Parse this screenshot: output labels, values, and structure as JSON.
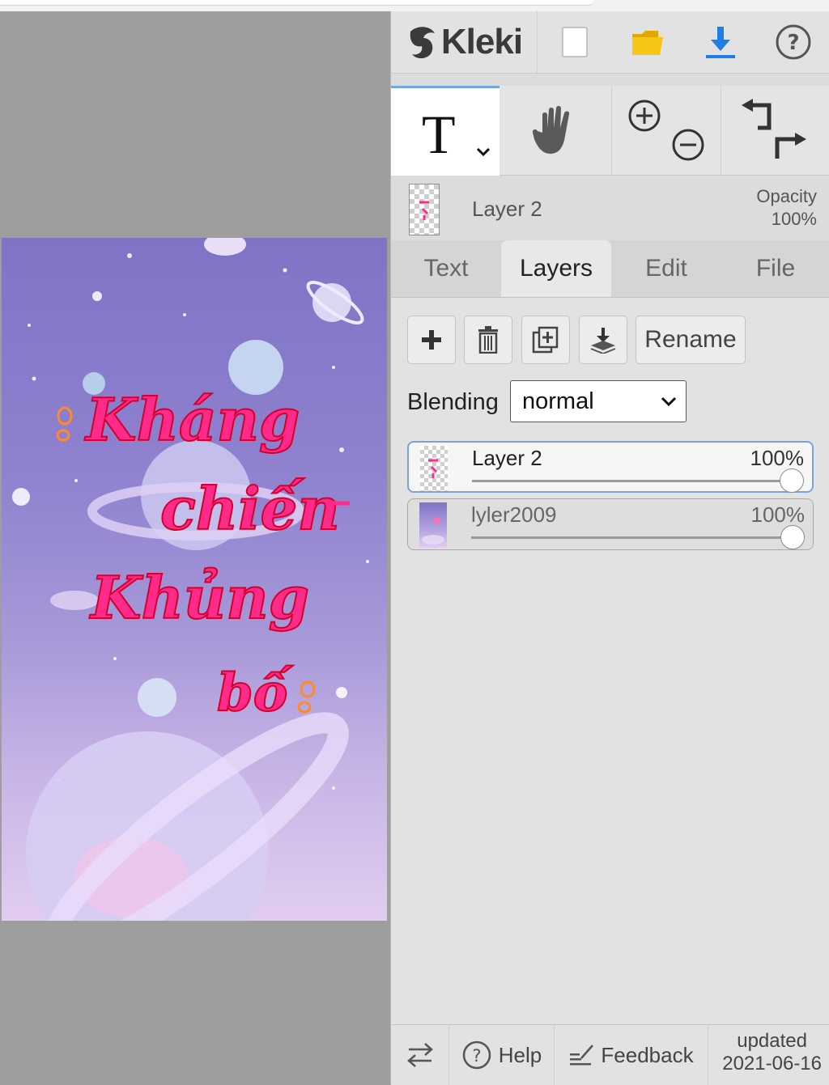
{
  "app": {
    "logo_text": "Kleki"
  },
  "toolbar": {
    "icons": [
      "new-image-icon",
      "open-folder-icon",
      "download-icon",
      "help-circle-icon"
    ]
  },
  "tools": {
    "active": "text-tool",
    "icons": [
      "text-tool-icon",
      "hand-tool-icon",
      "zoom-in-icon",
      "zoom-out-icon",
      "undo-icon",
      "redo-icon"
    ]
  },
  "current_layer": {
    "name": "Layer 2",
    "opacity_label": "Opacity",
    "opacity_value": "100%"
  },
  "tabs": [
    {
      "label": "Text"
    },
    {
      "label": "Layers"
    },
    {
      "label": "Edit"
    },
    {
      "label": "File"
    }
  ],
  "layers_panel": {
    "rename_label": "Rename",
    "blending_label": "Blending",
    "blending_value": "normal",
    "layers": [
      {
        "name": "Layer 2",
        "opacity": "100%",
        "opacity_fraction": 1.0,
        "selected": true
      },
      {
        "name": "lyler2009",
        "opacity": "100%",
        "opacity_fraction": 1.0,
        "selected": false
      }
    ]
  },
  "footer": {
    "help_label": "Help",
    "feedback_label": "Feedback",
    "updated_label": "updated",
    "updated_date": "2021-06-16"
  },
  "canvas": {
    "text_lines": [
      "Kháng",
      "chiến",
      "Khủng",
      "bố"
    ],
    "colors": {
      "text_fill": "#ff2b8a",
      "text_outline": "#d4002c",
      "accent": "#ff8a2a"
    }
  },
  "colors": {
    "accent_blue": "#1e7de6",
    "folder_yellow": "#f5c518",
    "selected_border": "#7aa3de"
  }
}
